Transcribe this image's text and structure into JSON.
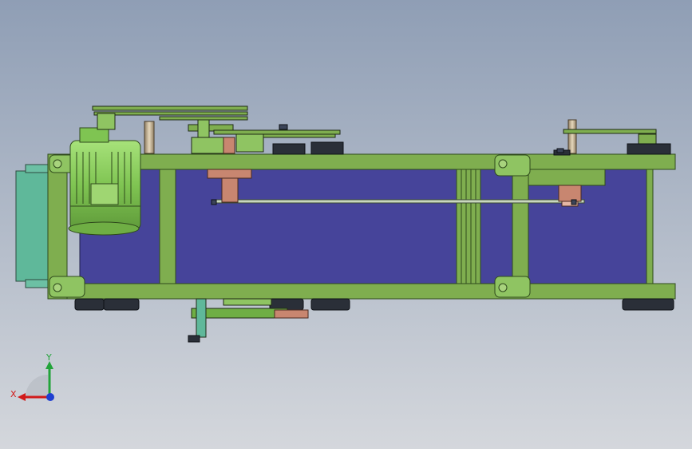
{
  "viewport": {
    "background_top": "#8f9eb5",
    "background_bottom": "#d4d7dc"
  },
  "model": {
    "frame_color": "#7fae4f",
    "frame_edge_color": "#2f4a1c",
    "conveyor_color": "#46449a",
    "motor_color": "#8dcf5f",
    "guard_color": "#5fb89a",
    "pulley_color": "#c88670",
    "shaft_color": "#c9b89a",
    "wheel_color": "#2a2f38"
  },
  "triad": {
    "x_label": "X",
    "y_label": "Y",
    "x_color": "#d11a1a",
    "y_color": "#22a33a",
    "z_color": "#1f3fd1"
  }
}
